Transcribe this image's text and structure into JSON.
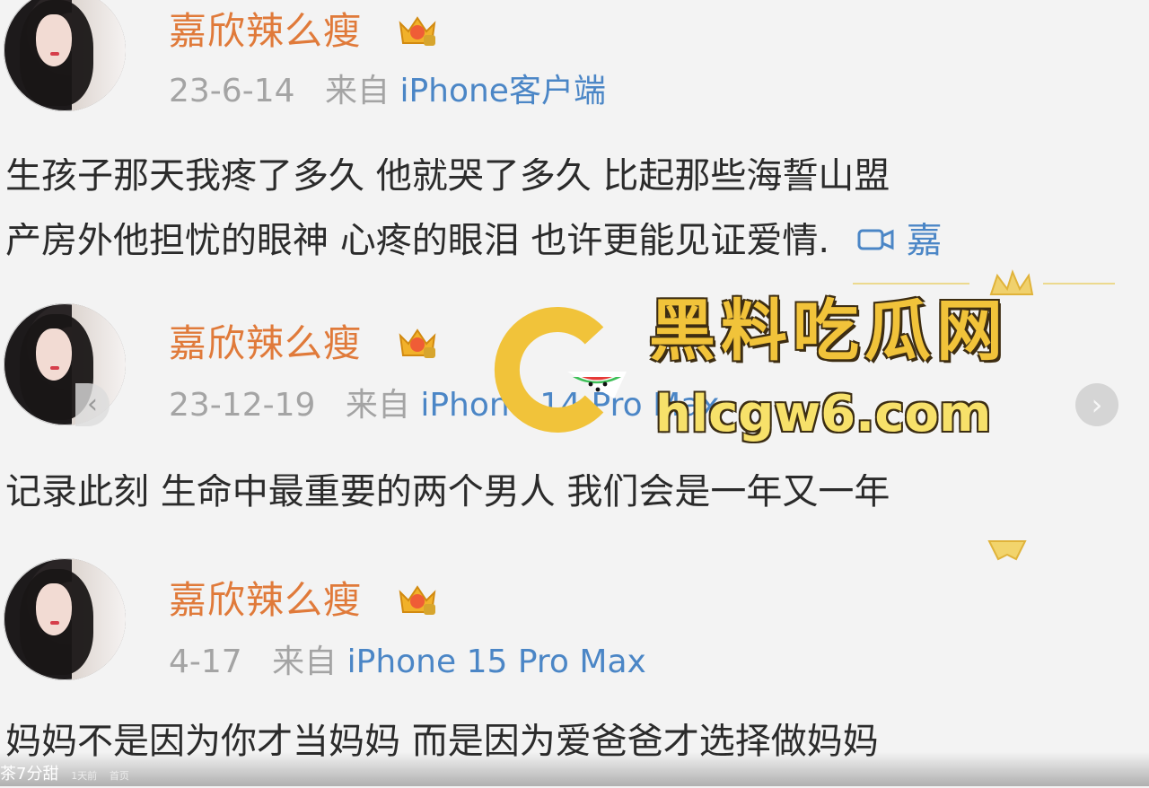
{
  "posts": [
    {
      "author": "嘉欣辣么瘦",
      "date": "23-6-14",
      "source_prefix": "来自",
      "source": "iPhone客户端",
      "lines": [
        "生孩子那天我疼了多久 他就哭了多久 比起那些海誓山盟",
        "产房外他担忧的眼神 心疼的眼泪 也许更能见证爱情."
      ],
      "video_prefix": "嘉"
    },
    {
      "author": "嘉欣辣么瘦",
      "date": "23-12-19",
      "source_prefix": "来自",
      "source": "iPhone 14 Pro Max",
      "lines": [
        "记录此刻 生命中最重要的两个男人 我们会是一年又一年"
      ]
    },
    {
      "author": "嘉欣辣么瘦",
      "date": "4-17",
      "source_prefix": "来自",
      "source": "iPhone 15 Pro Max",
      "lines": [
        "妈妈不是因为你才当妈妈 而是因为爱爸爸才选择做妈妈"
      ]
    }
  ],
  "watermark": {
    "title": "黑料吃瓜网",
    "url": "hlcgw6.com"
  },
  "carousel": {
    "next_icon": "›",
    "prev_icon": "‹"
  },
  "bottom_overlay": {
    "text": "茶7分甜",
    "extra": "1天前",
    "label": "首页"
  },
  "colors": {
    "author": "#e07a3a",
    "meta": "#a4a4a4",
    "source_link": "#4b86c6",
    "content": "#2b2b2b",
    "watermark_gold": "#f1c33a"
  },
  "icons": [
    "vip-crown-icon",
    "video-icon",
    "chevron-right-icon",
    "chevron-left-icon",
    "watermelon-logo-icon"
  ]
}
